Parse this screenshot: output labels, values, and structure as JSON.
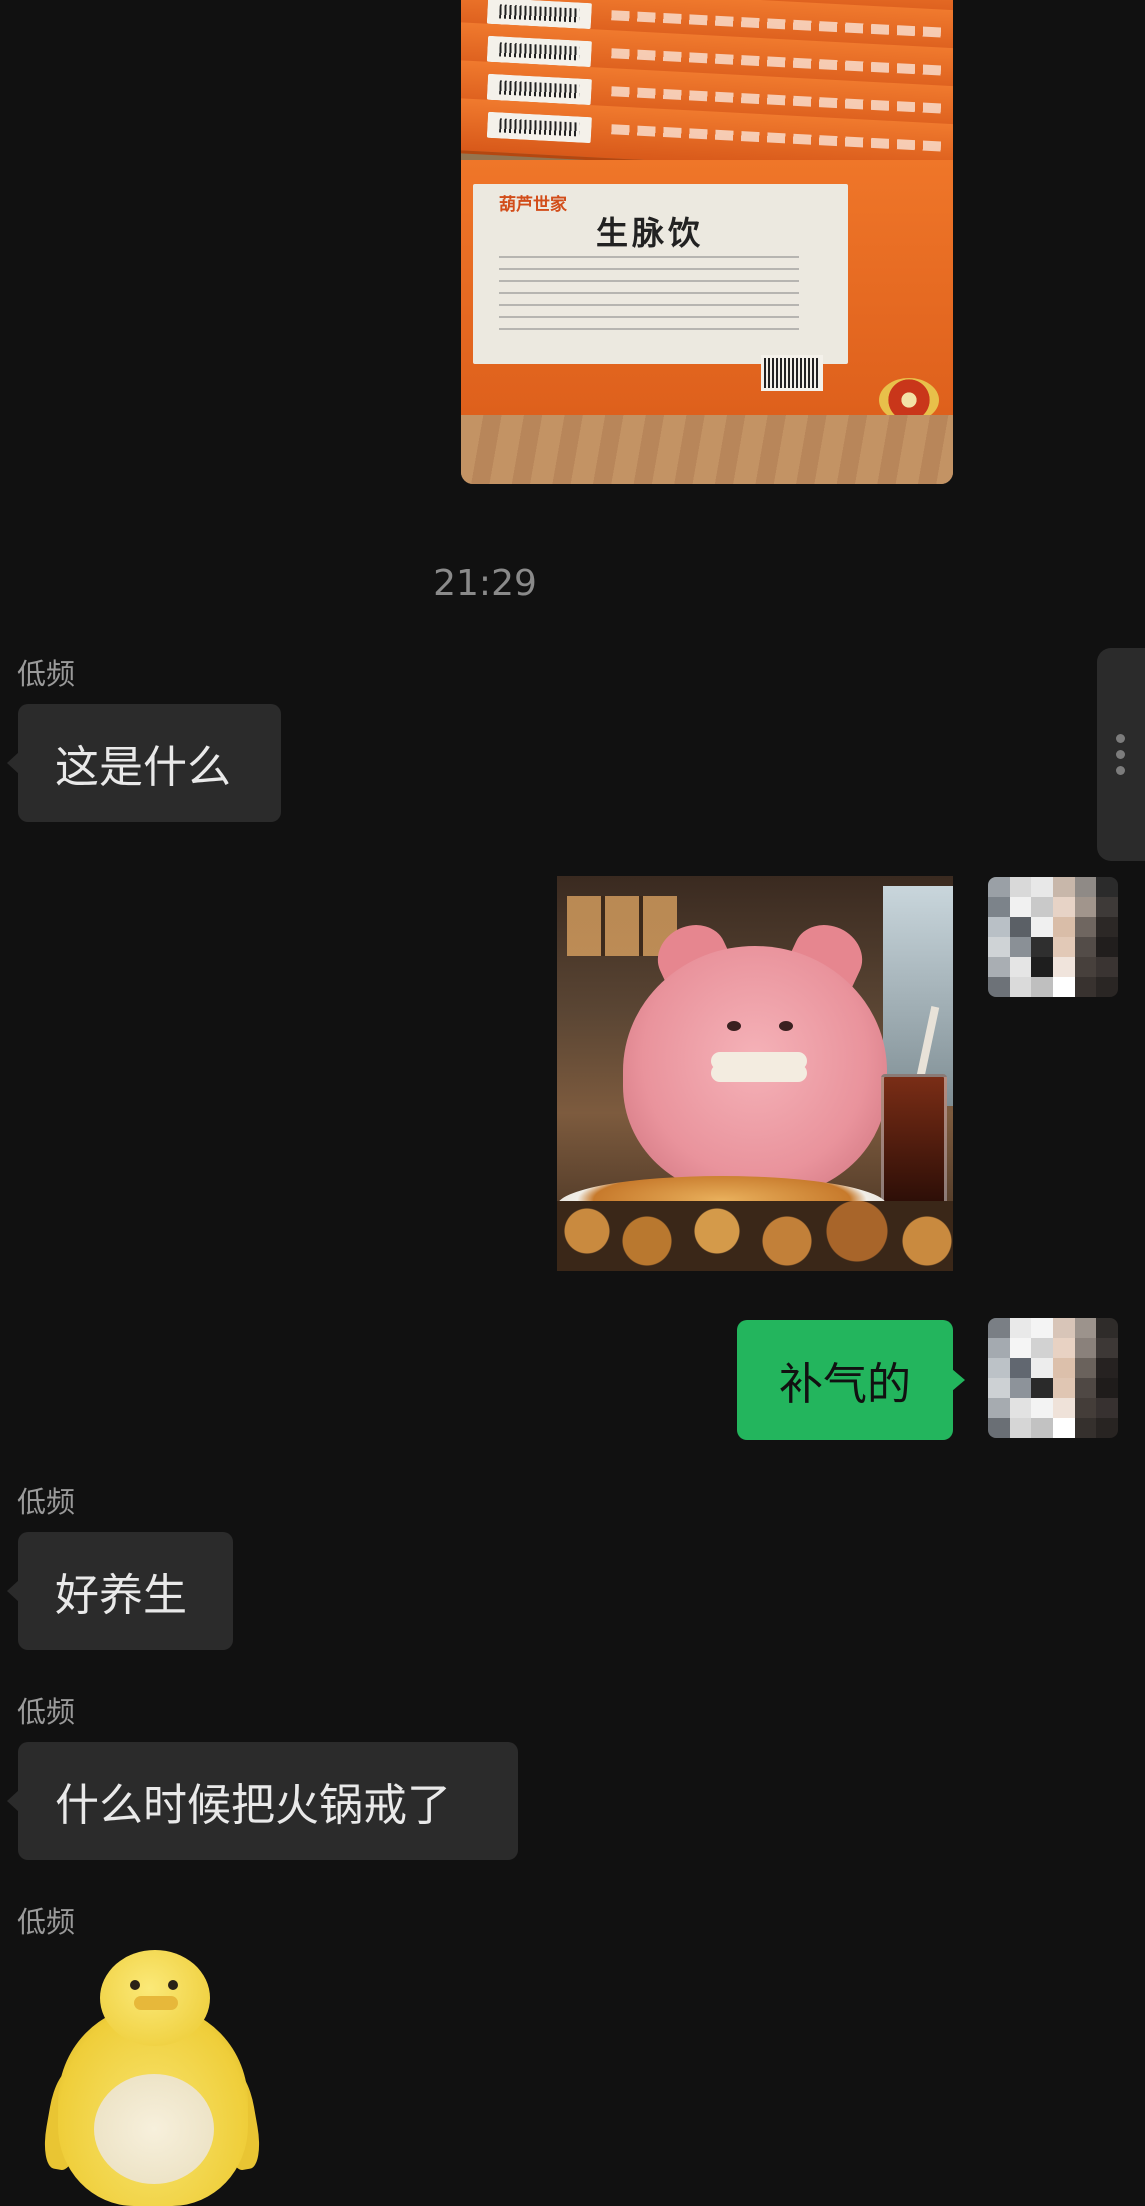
{
  "messages": {
    "timestamp": "21:29",
    "received_1": {
      "sender": "低频",
      "text": "这是什么"
    },
    "sent_1": {
      "text": "补气的"
    },
    "received_2": {
      "sender": "低频",
      "text": "好养生"
    },
    "received_3": {
      "sender": "低频",
      "text": "什么时候把火锅戒了"
    },
    "received_4": {
      "sender": "低频"
    }
  },
  "photo": {
    "brand": "葫芦世家",
    "product_name": "生脉饮"
  },
  "icons": {
    "options": "more-vertical-icon"
  },
  "colors": {
    "background": "#111111",
    "received_bubble": "#2b2b2b",
    "sent_bubble": "#23b55d",
    "meta_text": "#8a8a8a"
  }
}
